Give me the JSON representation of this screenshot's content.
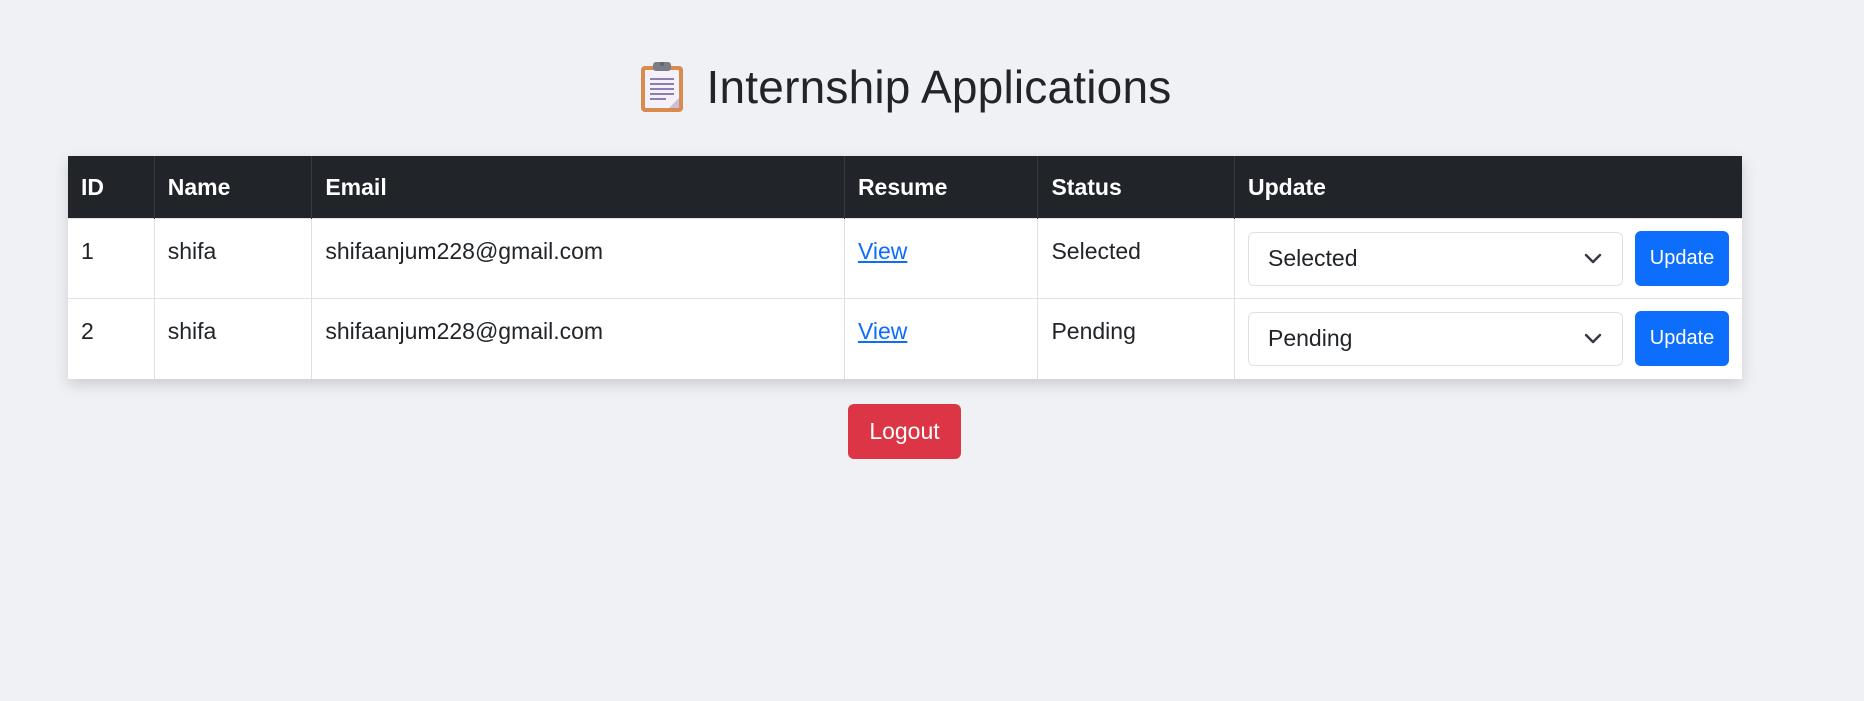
{
  "page": {
    "title": "Internship Applications",
    "title_icon": "clipboard-icon"
  },
  "table": {
    "headers": [
      "ID",
      "Name",
      "Email",
      "Resume",
      "Status",
      "Update"
    ],
    "rows": [
      {
        "id": "1",
        "name": "shifa",
        "email": "shifaanjum228@gmail.com",
        "resume_link": "View",
        "status": "Selected",
        "select_value": "Selected",
        "update_label": "Update"
      },
      {
        "id": "2",
        "name": "shifa",
        "email": "shifaanjum228@gmail.com",
        "resume_link": "View",
        "status": "Pending",
        "select_value": "Pending",
        "update_label": "Update"
      }
    ]
  },
  "logout_label": "Logout",
  "colors": {
    "page_bg": "#f0f1f5",
    "header_bg": "#212529",
    "primary": "#0d6efd",
    "danger": "#dc3545"
  }
}
